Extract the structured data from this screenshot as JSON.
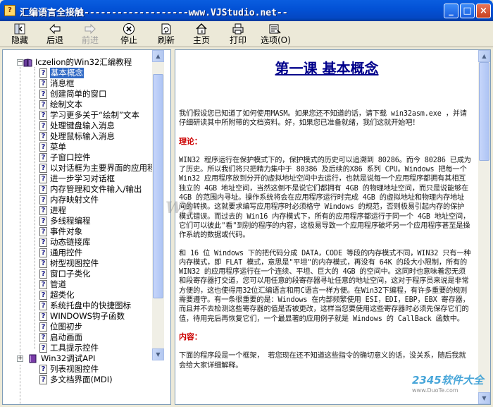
{
  "window": {
    "title": "汇编语言全接触-------------------www.VJStudio.net--",
    "controls": {
      "minimize": "_",
      "maximize": "□",
      "close": "×"
    }
  },
  "toolbar": {
    "hide": "隐藏",
    "back": "后退",
    "forward": "前进",
    "stop": "停止",
    "refresh": "刷新",
    "home": "主页",
    "print": "打印",
    "options": "选项(O)"
  },
  "tree": {
    "root": "Iczelion的Win32汇编教程",
    "items": [
      "基本概念",
      "消息框",
      "创建简单的窗口",
      "绘制文本",
      "学习更多关于“绘制”文本",
      "处理键盘输入消息",
      "处理鼠标输入消息",
      "菜单",
      "子窗口控件",
      "以对话框为主要界面的应用程",
      "进一步学习对话框",
      "内存管理和文件输入/输出",
      "内存映射文件",
      "进程",
      "多线程编程",
      "事件对象",
      "动态链接库",
      "通用控件",
      "树型视图控件",
      "窗口子类化",
      "管道",
      "超类化",
      "系统托盘中的快捷图标",
      "WINDOWS钩子函数",
      "位图初步",
      "启动画面",
      "工具提示控件"
    ],
    "book2": "Win32调试API",
    "items2": [
      "列表视图控件",
      "多文档界面(MDI)"
    ]
  },
  "content": {
    "title": "第一课  基本概念",
    "intro": "我们假设您已知道了如何使用MASM。如果您还不知道的话，请下载 win32asm.exe ，并请仔细研读其中所附带的文档资料。好，如果您已准备就绪，我们这就开始吧！",
    "theory_heading": "理论：",
    "theory_p1": "WIN32 程序运行在保护模式下的，保护模式的历史可以追溯到 80286。而今 80286 已成为了历史。所以我们将只把精力集中于 80386 及后续的X86 系列 CPU。Windows 把每一个 Win32 应用程序放到分开的虚拟地址空间中去运行，也就是说每一个应用程序都拥有其相互独立的 4GB 地址空间，当然这倒不是说它们都拥有 4GB 的物理地址空间，而只是说能够在 4GB 的范围内寻址。操作系统将会在应用程序运行时完成 4GB 的虚拟地址和物理内存地址间的转换。这就要求编写应用程序时必须格守 Windows 的规范，否则极易引起内存的保护模式错误。而过去的 Win16 内存模式下，所有的应用程序都运行于同一个 4GB 地址空间，它们可以彼此\"看\"到别的程序的内容，这极易导致一个应用程序破坏另一个应用程序甚至是操作系统的数据或代码。",
    "theory_p2": "和 16 位 Windows 下的把代码分成 DATA，CODE 等段的内存模式不同，WIN32 只有一种内存模式，即 FLAT 模式，意思是\"平坦\"的内存模式，再没有 64K 的段大小限制，所有的 WIN32 的应用程序运行在一个连续、平坦、巨大的 4GB 的空间中。这同时也意味着您无须和段寄存器打交道，您可以用任意的段寄存器寻址任意的地址空间，这对于程序员来说是非常方便的，这也使得用32位汇编语言和用C语言一样方便。在Win32下编程，有许多重要的规则需要遵守。有一条很重要的是：Windows 在内部频繁使用 ESI，EDI，EBP，EBX 寄存器，而且并不去检测这些寄存器的值是否被更改，这样当您要使用这些寄存器时必须先保存它们的值，待用完后再恢复它们，一个最显著的应用例子就是 Windows 的 CallBack 函数中。",
    "content_heading": "内容：",
    "content_p1": "下面的程序段是一个框架， 若您现在还不知道这些指令的确切意义的话，没关系，随后我就会给大家详细解释。"
  },
  "watermarks": {
    "left": "WA",
    "logo_main": "2345软件大全",
    "logo_url": "www.DuoTe.com"
  }
}
